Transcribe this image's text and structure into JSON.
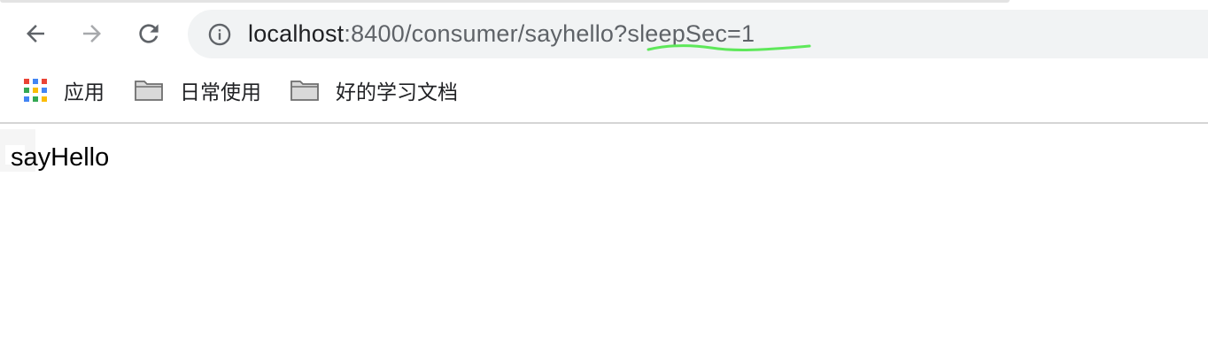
{
  "browser": {
    "nav": {
      "back_icon": "arrow-left-icon",
      "forward_icon": "arrow-right-icon",
      "reload_icon": "reload-icon"
    },
    "address_bar": {
      "info_icon": "info-icon",
      "host": "localhost",
      "rest": ":8400/consumer/sayhello?sleepSec=1",
      "annotation_color": "#5ee85a"
    },
    "bookmarks": [
      {
        "label": "应用",
        "icon": "apps-grid-icon"
      },
      {
        "label": "日常使用",
        "icon": "folder-icon"
      },
      {
        "label": "好的学习文档",
        "icon": "folder-icon"
      }
    ]
  },
  "page": {
    "body_text": "sayHello"
  }
}
